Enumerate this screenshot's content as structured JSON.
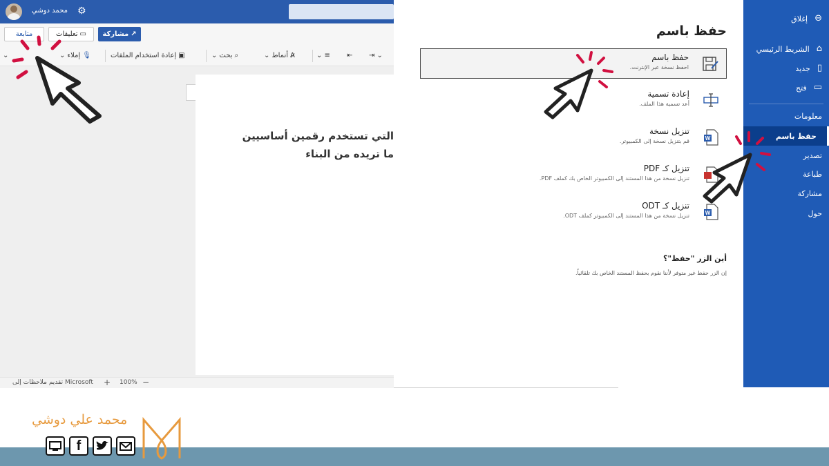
{
  "word": {
    "user_name": "محمد دوشي",
    "ribbon": {
      "follow_label": "متابعة",
      "comments_label": "تعليقات",
      "share_label": "مشاركة",
      "dictate_label": "إملاء",
      "reuse_label": "إعادة استخدام الملفات",
      "search_label": "بحث",
      "styles_label": "أنماط"
    },
    "document": {
      "line1": "التي تستخدم رقمين أساسيين",
      "line2": "ما تريده من البناء"
    },
    "status": {
      "zoom": "100%",
      "feedback": "تقديم ملاحظات إلى Microsoft"
    }
  },
  "backstage": {
    "title": "حفظ باسم",
    "options": [
      {
        "title": "حفظ باسم",
        "desc": "احفظ نسخة عبر الإنترنت.",
        "icon": "save-as-icon",
        "selected": true
      },
      {
        "title": "إعادة تسمية",
        "desc": "أعد تسمية هذا الملف.",
        "icon": "rename-icon",
        "selected": false
      },
      {
        "title": "تنزيل نسخة",
        "desc": "قم بتنزيل نسخة إلى الكمبيوتر.",
        "icon": "word-download-icon",
        "selected": false
      },
      {
        "title": "تنزيل كـ PDF",
        "desc": "تنزيل نسخة من هذا المستند إلى الكمبيوتر الخاص بك كملف PDF.",
        "icon": "pdf-download-icon",
        "selected": false
      },
      {
        "title": "تنزيل كـ ODT",
        "desc": "تنزيل نسخة من هذا المستند إلى الكمبيوتر كملف ODT.",
        "icon": "odt-download-icon",
        "selected": false
      }
    ],
    "question_title": "أين الزر \"حفظ\"؟",
    "question_desc": "إن الزر حفظ غير متوفر لأننا نقوم بحفظ المستند الخاص بك تلقائياً."
  },
  "nav": {
    "close": "إغلاق",
    "home": "الشريط الرئيسي",
    "new": "جديد",
    "open": "فتح",
    "info": "معلومات",
    "save_as": "حفظ باسم",
    "export": "تصدير",
    "print": "طباعة",
    "share": "مشاركة",
    "about": "حول"
  },
  "brand": {
    "name": "محمد علي دوشي"
  },
  "colors": {
    "word_blue": "#2b5cad",
    "nav_blue": "#1f5bb6",
    "nav_active": "#0b3e8c",
    "brand_orange": "#e79a3e",
    "footer_band": "#6d97ae",
    "cursor_accent": "#d11040"
  }
}
